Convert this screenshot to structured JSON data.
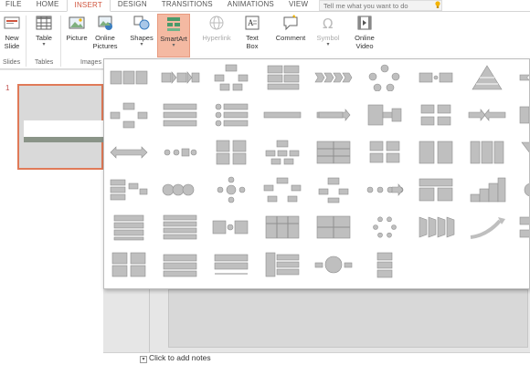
{
  "tabs": [
    "FILE",
    "HOME",
    "INSERT",
    "DESIGN",
    "TRANSITIONS",
    "ANIMATIONS",
    "VIEW"
  ],
  "tell_me": "Tell me what you want to do",
  "ribbon": {
    "new_slide": [
      "New",
      "Slide"
    ],
    "table": "Table",
    "picture": "Picture",
    "online_pictures": [
      "Online",
      "Pictures"
    ],
    "shapes": "Shapes",
    "smartart": "SmartArt",
    "hyperlink": "Hyperlink",
    "text_box": [
      "Text",
      "Box"
    ],
    "comment": "Comment",
    "symbol": "Symbol",
    "online_video": [
      "Online",
      "Video"
    ],
    "groups": {
      "slides": "Slides",
      "tables": "Tables",
      "images": "Images"
    }
  },
  "slide_number": "1",
  "notes_placeholder": "Click to add notes",
  "colors": {
    "accent": "#d0553e",
    "smartart_selected": "#f4b9a2",
    "shape_gray": "#bfbfbf"
  },
  "gallery": {
    "rows": [
      [
        "list-horizontal-bullets",
        "process-arrows",
        "hierarchy-tree",
        "block-list",
        "chevron-process",
        "cycle-circles",
        "process-dots",
        "pyramid",
        "arrow-ribbon"
      ],
      [
        "cycle-rectangles",
        "striped-list",
        "vertical-list-icons",
        "chevron-bar",
        "large-arrow",
        "arrow-split",
        "cycle-boxes",
        "converging-arrows",
        "process-boxes"
      ],
      [
        "double-arrow",
        "circle-process",
        "grid-list",
        "org-chart",
        "table-grid",
        "matrix-2x2",
        "list-boxes",
        "matrix-stack",
        "inverted-pyramid"
      ],
      [
        "labeled-hierarchy",
        "linked-circles",
        "radial-cycle",
        "cycle-pentagon",
        "hierarchy-small",
        "chevron-dots",
        "table-list",
        "staircase",
        "radial-circles"
      ],
      [
        "vertical-process",
        "stacked-bars",
        "descending-list",
        "table-large",
        "table-columns",
        "dotted-cycle",
        "funnel-steps",
        "rising-arrow",
        "list-arrows"
      ],
      [
        "picture-grid",
        "horizontal-bars",
        "bracket-list",
        "bullet-picture-list",
        "circle-radial",
        "vertical-flow"
      ]
    ]
  }
}
